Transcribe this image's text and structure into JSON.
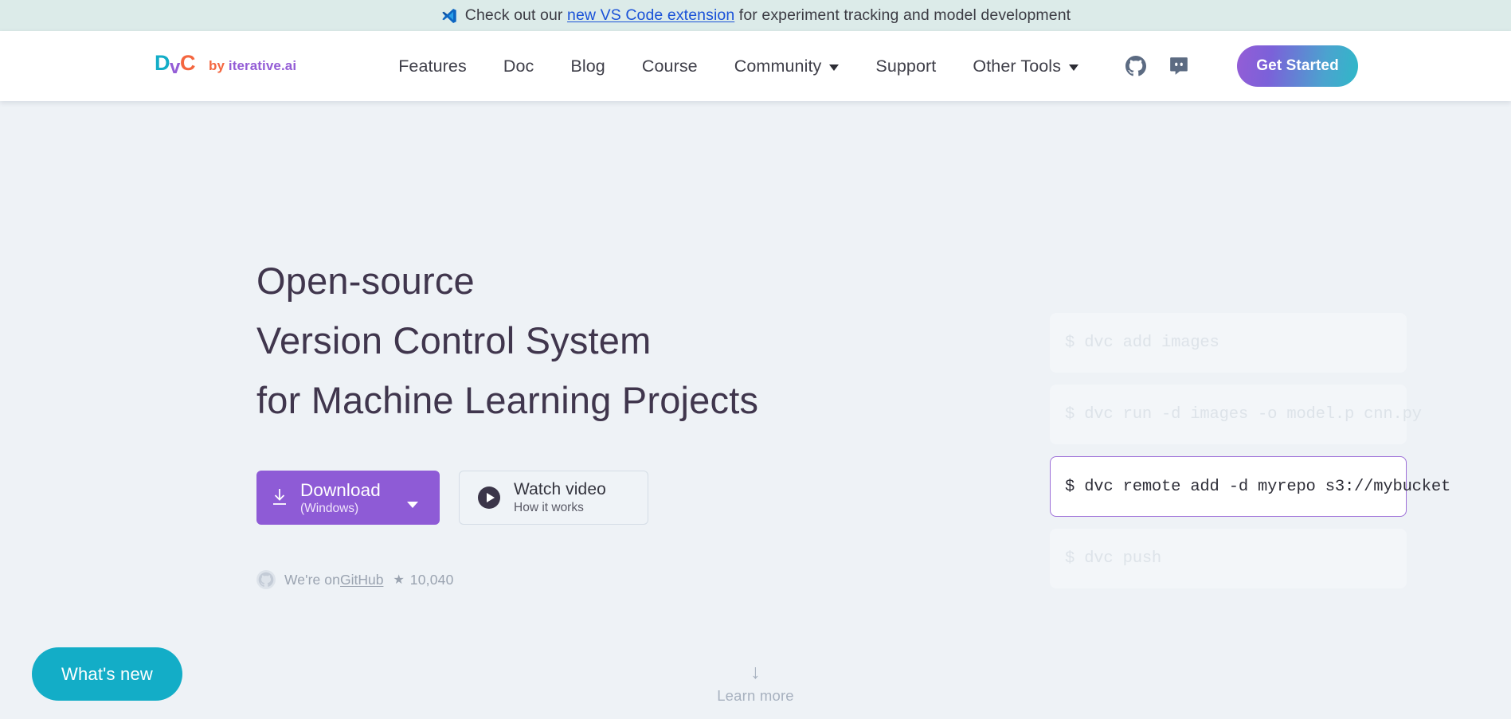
{
  "banner": {
    "icon": "vscode-icon",
    "text_before": "Check out our",
    "link_label": "new VS Code extension",
    "text_after": "for experiment tracking and model development",
    "background": "#dcebe9",
    "link_color": "#1a52d8"
  },
  "navbar": {
    "logo": {
      "mark": "dvc-logo",
      "letters": [
        "D",
        "v",
        "C"
      ],
      "colors": [
        "#13adc7",
        "#945dd6",
        "#f4663f"
      ],
      "by_prefix": "by ",
      "by_name": "iterative.ai"
    },
    "items": [
      {
        "label": "Features",
        "has_caret": false
      },
      {
        "label": "Doc",
        "has_caret": false
      },
      {
        "label": "Blog",
        "has_caret": false
      },
      {
        "label": "Course",
        "has_caret": false
      },
      {
        "label": "Community",
        "has_caret": true
      },
      {
        "label": "Support",
        "has_caret": false
      },
      {
        "label": "Other Tools",
        "has_caret": true
      }
    ],
    "icons": [
      {
        "name": "github-icon"
      },
      {
        "name": "discord-icon"
      }
    ],
    "cta": {
      "label": "Get Started",
      "gradient_from": "#945dd6",
      "gradient_to": "#2fb8c8"
    }
  },
  "hero": {
    "background": "#eef2f6",
    "headline_lines": [
      "Open-source",
      "Version Control System",
      "for Machine Learning Projects"
    ],
    "headline_color": "#40364d",
    "download": {
      "icon": "download-icon",
      "title": "Download",
      "subtitle": "(Windows)",
      "color": "#8e5bd6",
      "caret": "chevron-down-icon"
    },
    "watch": {
      "icon": "play-icon",
      "title": "Watch video",
      "subtitle": "How it works"
    },
    "github": {
      "icon": "github-icon",
      "prefix": "We're on ",
      "link_label": "GitHub",
      "star_glyph": "★",
      "stars": "10,040"
    },
    "terminal": [
      {
        "command": "$ dvc add images",
        "active": false
      },
      {
        "command": "$ dvc run -d images -o model.p cnn.py",
        "active": false
      },
      {
        "command": "$ dvc remote add -d myrepo s3://mybucket",
        "active": true
      },
      {
        "command": "$ dvc push",
        "active": false
      }
    ],
    "terminal_active_border": "#9d6fd8"
  },
  "footer_widgets": {
    "whats_new": {
      "label": "What's new",
      "color": "#13adc7"
    },
    "learn_more": {
      "arrow": "↓",
      "label": "Learn more"
    }
  }
}
